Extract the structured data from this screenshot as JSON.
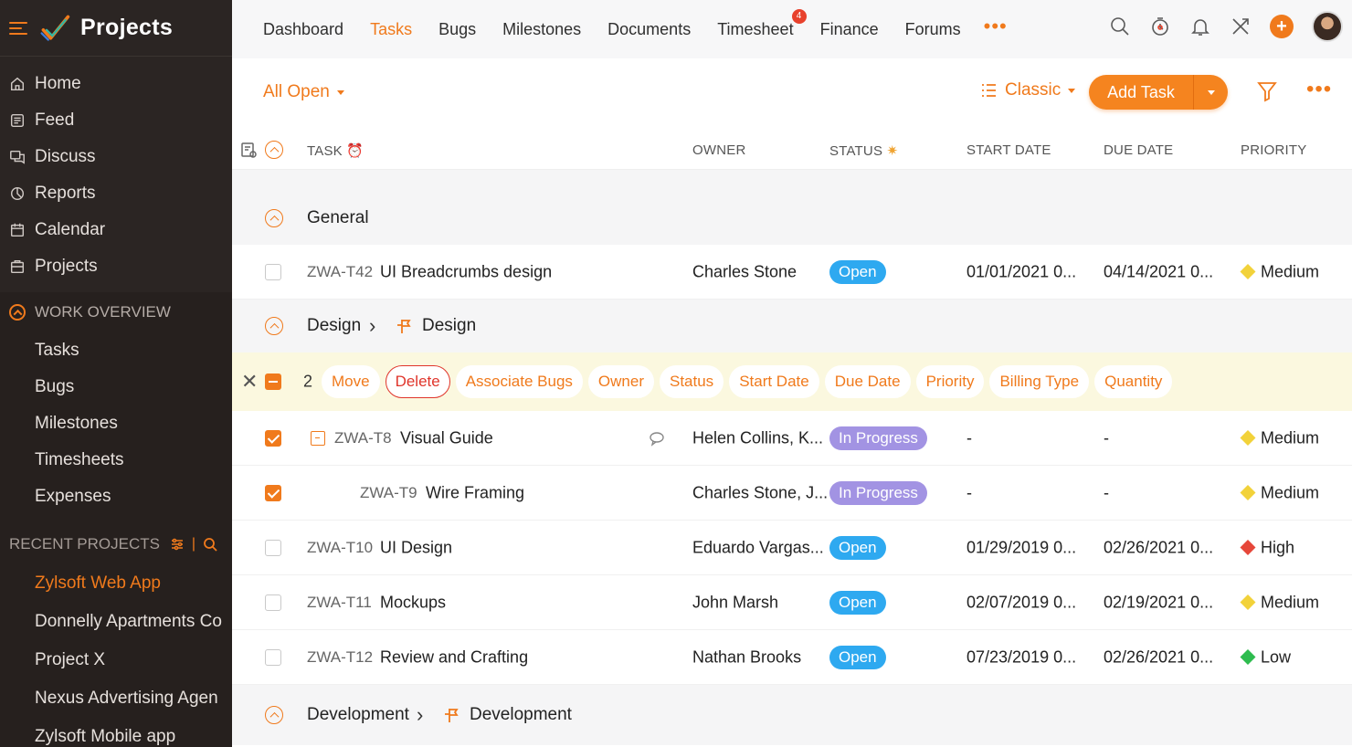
{
  "app": {
    "title": "Projects"
  },
  "sidebar": {
    "items": [
      {
        "label": "Home",
        "icon": "home-icon"
      },
      {
        "label": "Feed",
        "icon": "feed-icon"
      },
      {
        "label": "Discuss",
        "icon": "discuss-icon"
      },
      {
        "label": "Reports",
        "icon": "reports-icon"
      },
      {
        "label": "Calendar",
        "icon": "calendar-icon"
      },
      {
        "label": "Projects",
        "icon": "projects-icon"
      }
    ],
    "work_overview": {
      "heading": "WORK OVERVIEW",
      "items": [
        "Tasks",
        "Bugs",
        "Milestones",
        "Timesheets",
        "Expenses"
      ]
    },
    "recent_projects": {
      "heading": "RECENT PROJECTS",
      "items": [
        "Zylsoft Web App",
        "Donnelly Apartments Co",
        "Project X",
        "Nexus Advertising Agen",
        "Zylsoft Mobile app"
      ]
    }
  },
  "topnav": {
    "tabs": [
      "Dashboard",
      "Tasks",
      "Bugs",
      "Milestones",
      "Documents",
      "Timesheet",
      "Finance",
      "Forums"
    ],
    "active_tab": "Tasks",
    "timesheet_badge": "4",
    "more": "•••"
  },
  "toolbar": {
    "filter": "All Open",
    "view": "Classic",
    "add_task": "Add Task",
    "more": "•••"
  },
  "columns": {
    "task": "TASK",
    "owner": "OWNER",
    "status": "STATUS",
    "start_date": "START DATE",
    "due_date": "DUE DATE",
    "priority": "PRIORITY"
  },
  "groups": {
    "general": {
      "name": "General"
    },
    "design": {
      "name": "Design",
      "sub": "Design"
    },
    "development": {
      "name": "Development",
      "sub": "Development"
    }
  },
  "tasks": [
    {
      "id": "ZWA-T42",
      "name": "UI Breadcrumbs design",
      "owner": "Charles Stone",
      "status": "Open",
      "start": "01/01/2021 0...",
      "due": "04/14/2021 0...",
      "priority": "Medium"
    },
    {
      "id": "ZWA-T8",
      "name": "Visual Guide",
      "owner": "Helen Collins, K...",
      "status": "In Progress",
      "start": "-",
      "due": "-",
      "priority": "Medium"
    },
    {
      "id": "ZWA-T9",
      "name": "Wire Framing",
      "owner": "Charles Stone, J...",
      "status": "In Progress",
      "start": "-",
      "due": "-",
      "priority": "Medium"
    },
    {
      "id": "ZWA-T10",
      "name": "UI Design",
      "owner": "Eduardo Vargas...",
      "status": "Open",
      "start": "01/29/2019 0...",
      "due": "02/26/2021 0...",
      "priority": "High"
    },
    {
      "id": "ZWA-T11",
      "name": "Mockups",
      "owner": "John Marsh",
      "status": "Open",
      "start": "02/07/2019 0...",
      "due": "02/19/2021 0...",
      "priority": "Medium"
    },
    {
      "id": "ZWA-T12",
      "name": "Review and Crafting",
      "owner": "Nathan Brooks",
      "status": "Open",
      "start": "07/23/2019 0...",
      "due": "02/26/2021 0...",
      "priority": "Low"
    }
  ],
  "bulk": {
    "count": "2",
    "actions": [
      "Move",
      "Delete",
      "Associate Bugs",
      "Owner",
      "Status",
      "Start Date",
      "Due Date",
      "Priority",
      "Billing Type",
      "Quantity"
    ]
  },
  "colors": {
    "accent": "#f07a1c",
    "status_open": "#2ea9f0",
    "status_in_progress": "#a293e3",
    "priority_medium": "#f2d23a",
    "priority_high": "#e6473a",
    "priority_low": "#2ebc4f"
  }
}
